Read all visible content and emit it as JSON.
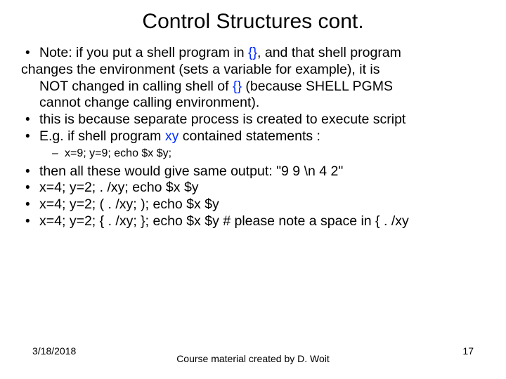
{
  "title": "Control Structures cont.",
  "bullets": {
    "b1a": "Note: if you put a shell program in ",
    "b1b": ", and that shell program",
    "b1_wrap": "changes the environment (sets a variable for example), it is",
    "b1_indent1": "NOT changed in calling shell of ",
    "b1_indent1b": " (because SHELL PGMS",
    "b1_indent2": "cannot change calling environment).",
    "b2": "this is because separate process is created to execute script",
    "b3a": "E.g. if shell program ",
    "b3b": " contained statements :",
    "sub1": "x=9; y=9; echo $x $y;",
    "b4": "then all these would give same output: \"9 9 \\n 4 2\"",
    "b5": "x=4; y=2;   . /xy;    echo $x $y",
    "b6": "x=4; y=2; ( . /xy; ); echo $x $y",
    "b7": "x=4; y=2; { . /xy; }; echo $x $y   # please note a space in { . /xy"
  },
  "inline": {
    "braces1": "{}",
    "braces2": "{}",
    "xy": "xy"
  },
  "footer": {
    "date": "3/18/2018",
    "center": "Course material created by D. Woit",
    "page": "17"
  }
}
